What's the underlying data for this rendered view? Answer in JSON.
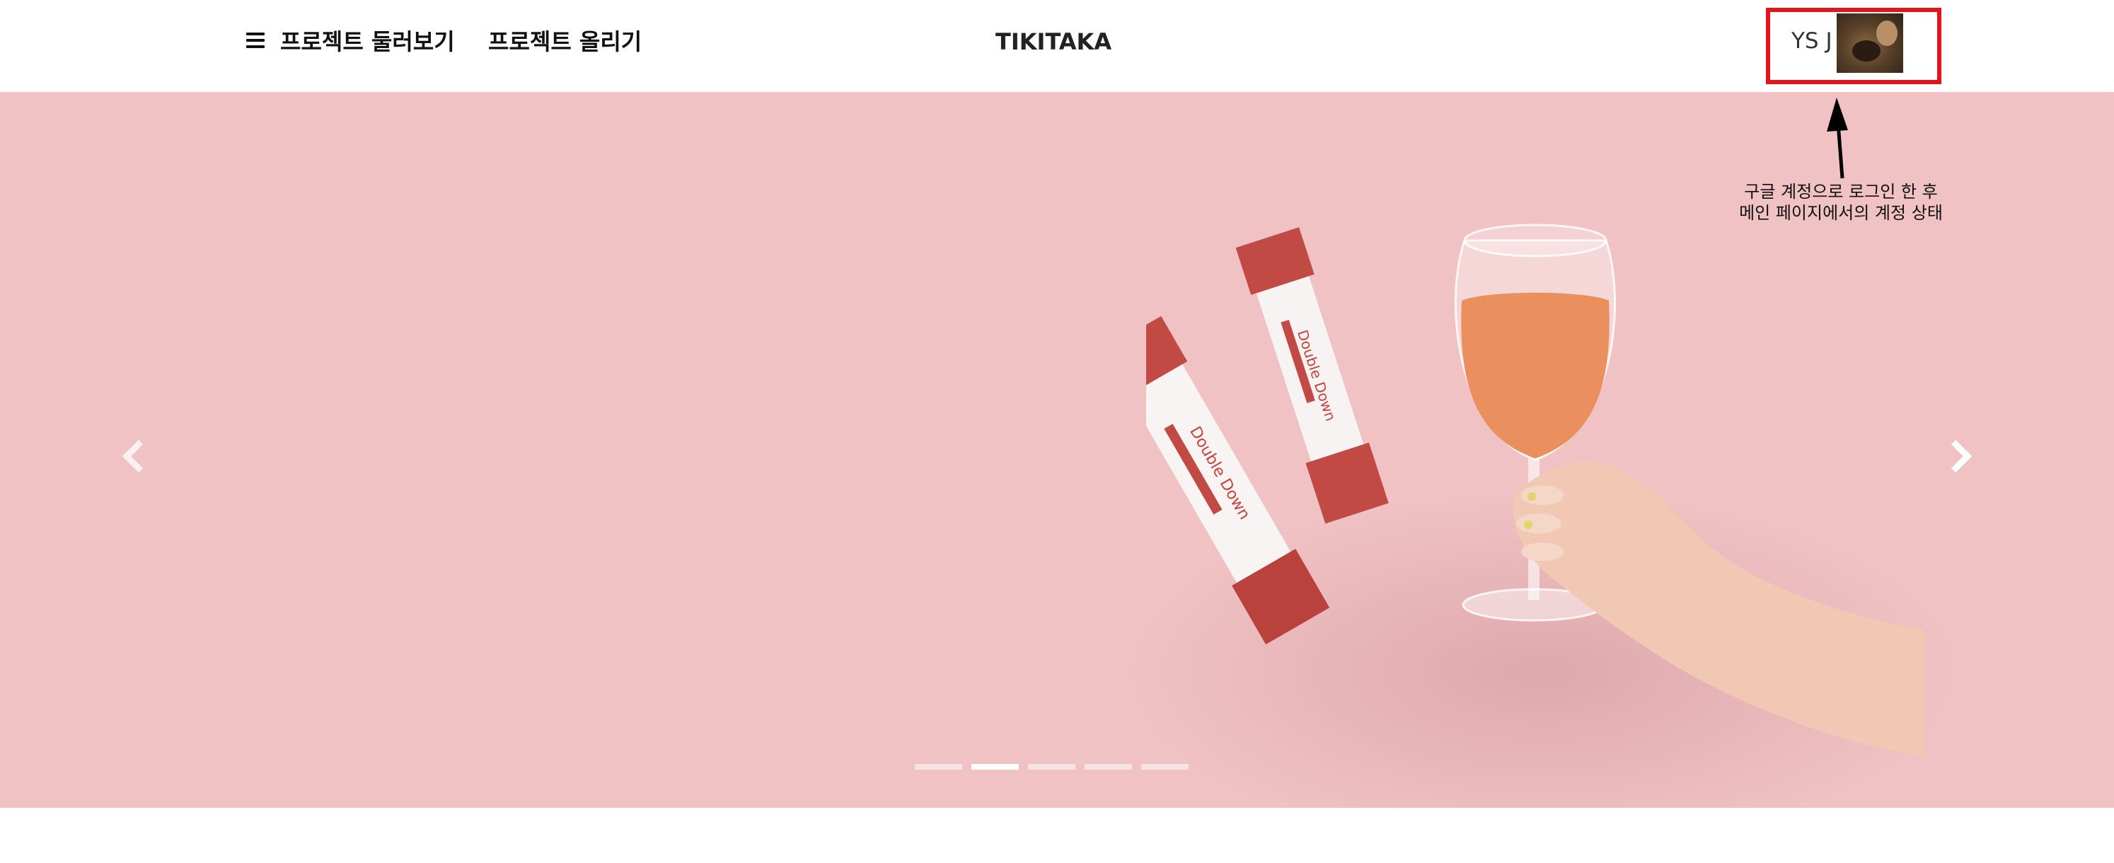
{
  "header": {
    "browse_label": "프로젝트 둘러보기",
    "upload_label": "프로젝트 올리기",
    "logo": "TIKITAKA",
    "account": {
      "name": "YS J",
      "highlight_color": "#e5141b"
    }
  },
  "hero": {
    "background_color": "#f0c2c4",
    "image_description_icon": "product-sticks-wine-glass-image",
    "product_text": "Double Down",
    "slide_count": 5,
    "active_slide": 2
  },
  "annotation": {
    "line1": "구글 계정으로 로그인 한 후",
    "line2": "메인 페이지에서의 계정 상태"
  },
  "icons": {
    "menu": "hamburger-icon",
    "prev": "chevron-left-icon",
    "next": "chevron-right-icon",
    "arrow": "arrow-up-icon"
  }
}
